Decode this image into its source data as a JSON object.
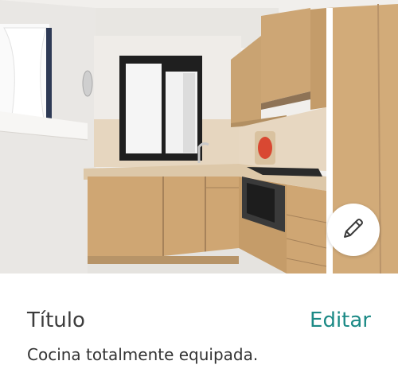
{
  "photo": {
    "subject_icon": "kitchen-photo"
  },
  "edit_button": {
    "icon": "pencil-icon"
  },
  "caption": {
    "title": "Título",
    "edit_label": "Editar",
    "description": "Cocina totalmente equipada."
  },
  "colors": {
    "accent": "#1c8a86",
    "title_text": "#3c3c3c",
    "body_text": "#333333",
    "background": "#ffffff"
  }
}
